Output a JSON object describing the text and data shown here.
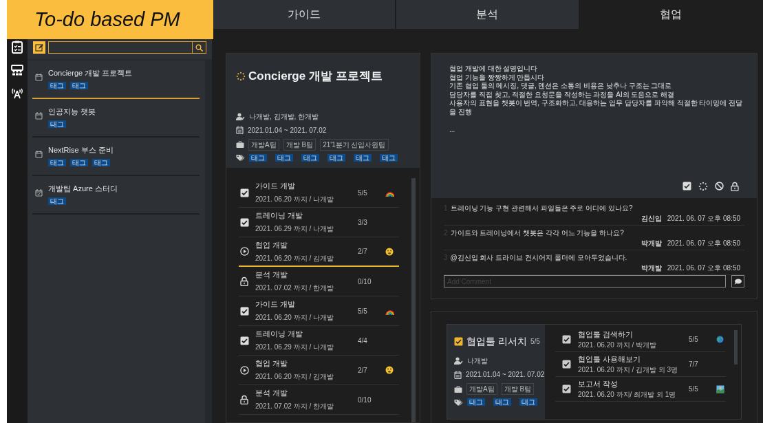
{
  "logo": {
    "text": "To-do based PM"
  },
  "tabs": [
    {
      "label": "가이드",
      "selected": false
    },
    {
      "label": "분석",
      "selected": false
    },
    {
      "label": "협업",
      "selected": true
    }
  ],
  "projects": [
    {
      "title": "Concierge 개발 프로젝트",
      "kind": "calendar",
      "selected": true,
      "tags": [
        "태그",
        "태그"
      ]
    },
    {
      "title": "인공지능 챗봇",
      "kind": "calendar",
      "selected": false,
      "tags": [
        "태그"
      ]
    },
    {
      "title": "NextRise 부스 준비",
      "kind": "calendar",
      "selected": false,
      "tags": [
        "태그",
        "태그",
        "태그"
      ]
    },
    {
      "title": "개발팀 Azure 스터디",
      "kind": "calendar-check",
      "selected": false,
      "tags": [
        "태그"
      ]
    }
  ],
  "project_detail": {
    "title": "Concierge 개발 프로젝트",
    "members": "나개발, 김개발, 한개발",
    "period": "2021.01.04 ~ 2021. 07.02",
    "teams": [
      "개발A팀",
      "개발 B팀",
      "21'1분기 신입사원팀"
    ],
    "tags": [
      "태그",
      "태그",
      "태그",
      "태그",
      "태그",
      "태그"
    ]
  },
  "tasks": [
    {
      "kind": "done",
      "title": "가이드 개발",
      "due": "2021. 06.20 까지 / 나개발",
      "count": "5/5",
      "emoji": {
        "kind": "rainbow"
      },
      "selected": false
    },
    {
      "kind": "done",
      "title": "트레이닝 개발",
      "due": "2021. 06.29 까지 / 나개발",
      "count": "3/3",
      "selected": false
    },
    {
      "kind": "in-progress",
      "title": "협업 개발",
      "due": "2021. 06.20 까지 / 김개발",
      "count": "2/7",
      "emoji": {
        "kind": "face"
      },
      "selected": true
    },
    {
      "kind": "locked",
      "title": "분석 개발",
      "due": "2021. 07.02 까지 / 한개발",
      "count": "0/10",
      "selected": false
    },
    {
      "kind": "done",
      "title": "가이드 개발",
      "due": "2021. 06.20 까지 / 나개발",
      "count": "5/5",
      "emoji": {
        "kind": "rainbow"
      },
      "selected": false
    },
    {
      "kind": "done",
      "title": "트레이닝 개발",
      "due": "2021. 06.29 까지 / 나개발",
      "count": "4/4",
      "selected": false
    },
    {
      "kind": "in-progress",
      "title": "협업 개발",
      "due": "2021. 06.20 까지 / 김개발",
      "count": "2/7",
      "emoji": {
        "kind": "face"
      },
      "selected": false
    },
    {
      "kind": "locked",
      "title": "분석 개발",
      "due": "2021. 07.02 까지 / 한개발",
      "count": "0/10",
      "selected": false
    }
  ],
  "description": {
    "lines": [
      "협업 개발에 대한 설명입니다",
      "협업 기능을 짱짱하게 만듭시다",
      "기존 협업 툴의 메시징, 댓글, 멘션은 소통의 비용은 낮추나 구조는 그대로",
      "담당자를 직접 찾고, 적절한 요청문을 작성하는 과정을 AI의 도움으로 해결",
      "사용자의 표현을 챗봇이 번역, 구조화하고, 대응하는 업무 담당자를 파악해 적절한 타이밍에 전달을 진행"
    ],
    "more": "..."
  },
  "comments": [
    {
      "number": "1",
      "text": "트레이닝 기능 구현 관련해서 파일들은 주로 어디에 있나요?",
      "author": "김신입",
      "time": "2021. 06. 07 오후 08:50"
    },
    {
      "number": "2",
      "text": "가이드와 트레이닝에서 챗봇은 각각 어느 기능을 하나요?",
      "author": "박개발",
      "time": "2021. 06. 07 오후 08:50"
    },
    {
      "number": "3",
      "text": "@김신입  회사 드라이브 컨시어지 폴더에 모아두었습니다.",
      "author": "박개발",
      "time": "2021. 06. 07 오후 08:50"
    }
  ],
  "comment_input": {
    "placeholder": "Add Comment"
  },
  "subproject": {
    "checked": true,
    "title": "협업툴 리서치",
    "count": "5/5",
    "members": "나개발",
    "period": "2021.01.04 ~ 2021. 07.02",
    "teams": [
      "개발A팀",
      "개발 B팀"
    ],
    "tags": [
      "태그",
      "태그",
      "태그"
    ],
    "tasks": [
      {
        "checked": true,
        "title": "협업툴 검색하기",
        "due": "2021. 06.20 까지 / 박개발",
        "count": "5/5",
        "emoji": {
          "kind": "globe"
        }
      },
      {
        "checked": true,
        "title": "협업툴 사용해보기",
        "due": "2021. 06.20 까지 / 김개발 외 3명",
        "count": "7/7"
      },
      {
        "checked": true,
        "title": "보고서 작성",
        "due": "2021. 06.20 까지/ 최개발 외 1명",
        "count": "5/5",
        "emoji": {
          "kind": "picture"
        }
      }
    ]
  }
}
